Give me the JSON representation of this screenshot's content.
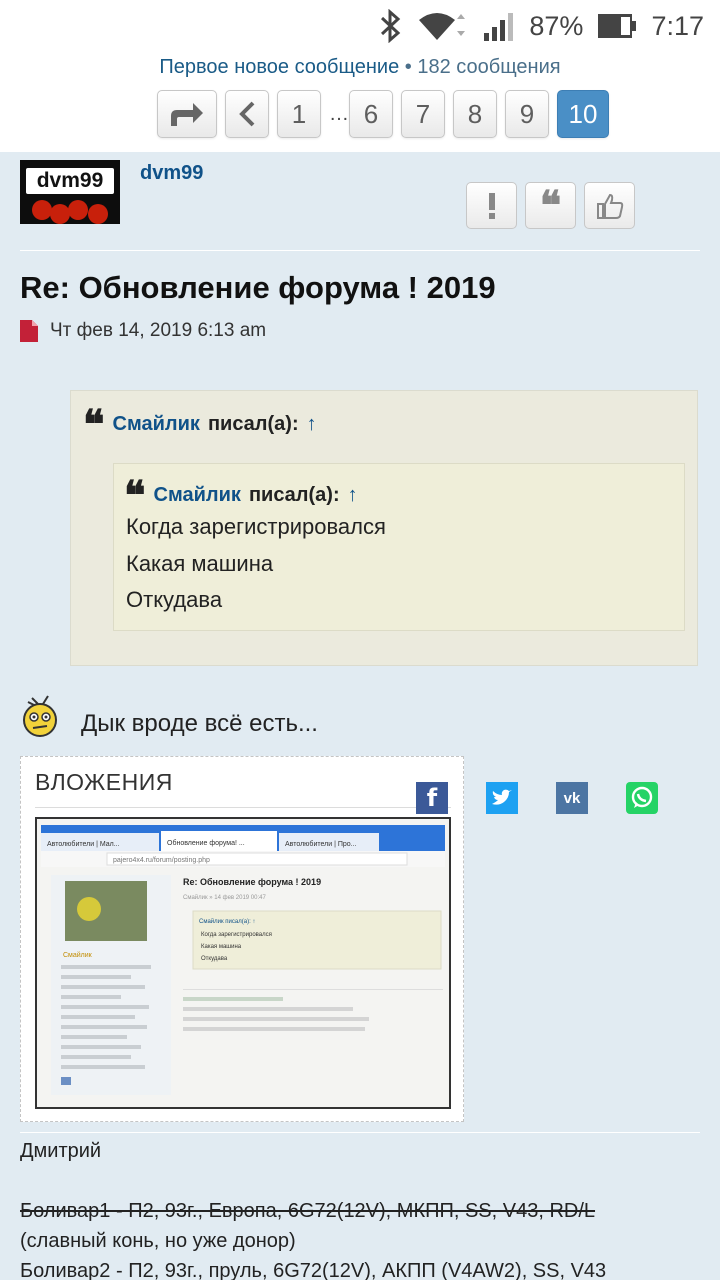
{
  "status_bar": {
    "battery": "87%",
    "time": "7:17"
  },
  "topic": {
    "first_new_label": "Первое новое сообщение",
    "separator": " • ",
    "post_count": "182 сообщения",
    "pages": [
      "1",
      "6",
      "7",
      "8",
      "9",
      "10"
    ],
    "ellipsis": "…",
    "current_page": "10"
  },
  "post": {
    "avatar_text": "dvm99",
    "author": "dvm99",
    "title": "Re: Обновление форума ! 2019",
    "date": "Чт фев 14, 2019 6:13 am",
    "outer_quote": {
      "author": "Смайлик",
      "wrote": "писал(а):",
      "arrow": "↑"
    },
    "inner_quote": {
      "author": "Смайлик",
      "wrote": "писал(а):",
      "arrow": "↑",
      "lines": [
        "Когда зарегистрировался",
        "Какая машина",
        "Откудава"
      ]
    },
    "text": "Дык вроде всё есть...",
    "attachments_label": "ВЛОЖЕНИЯ",
    "thumbnail": {
      "tab1": "Автолюбители | Мал...",
      "tab2": "Обновление форума! ...",
      "tab3": "Автолюбители | Про...",
      "url": "pajero4x4.ru/forum/posting.php",
      "title": "Re: Обновление форума ! 2019",
      "meta": "Смайлик » 14 фев 2019 00:47",
      "quote_head": "Смайлик писал(а): ↑",
      "quote_lines": [
        "Когда зарегистрировался",
        "Какая машина",
        "Откудава"
      ],
      "side_name": "Смайлик"
    },
    "signature": {
      "name": "Дмитрий",
      "line1": "Боливар1 - П2, 93г., Европа, 6G72(12V), МКПП, SS, V43, RD/L",
      "line2": "(славный конь, но уже донор)",
      "line3": "Боливар2 - П2, 93г., пруль, 6G72(12V), АКПП (V4AW2), SS, V43"
    }
  },
  "colors": {
    "link": "#105289",
    "post_bg": "#e1ebf2",
    "active_page": "#4a8fc6",
    "quote_bg": "#ebeadd",
    "facebook": "#3b5998",
    "twitter": "#1da1f2",
    "vk": "#4c75a3",
    "whatsapp": "#25d366"
  },
  "icons": [
    "bluetooth-icon",
    "wifi-icon",
    "signal-icon",
    "battery-icon",
    "share-icon",
    "chevron-left-icon",
    "report-icon",
    "quote-icon",
    "thumbs-up-icon",
    "file-icon",
    "smiley-icon",
    "facebook-icon",
    "twitter-icon",
    "vk-icon",
    "whatsapp-icon"
  ]
}
